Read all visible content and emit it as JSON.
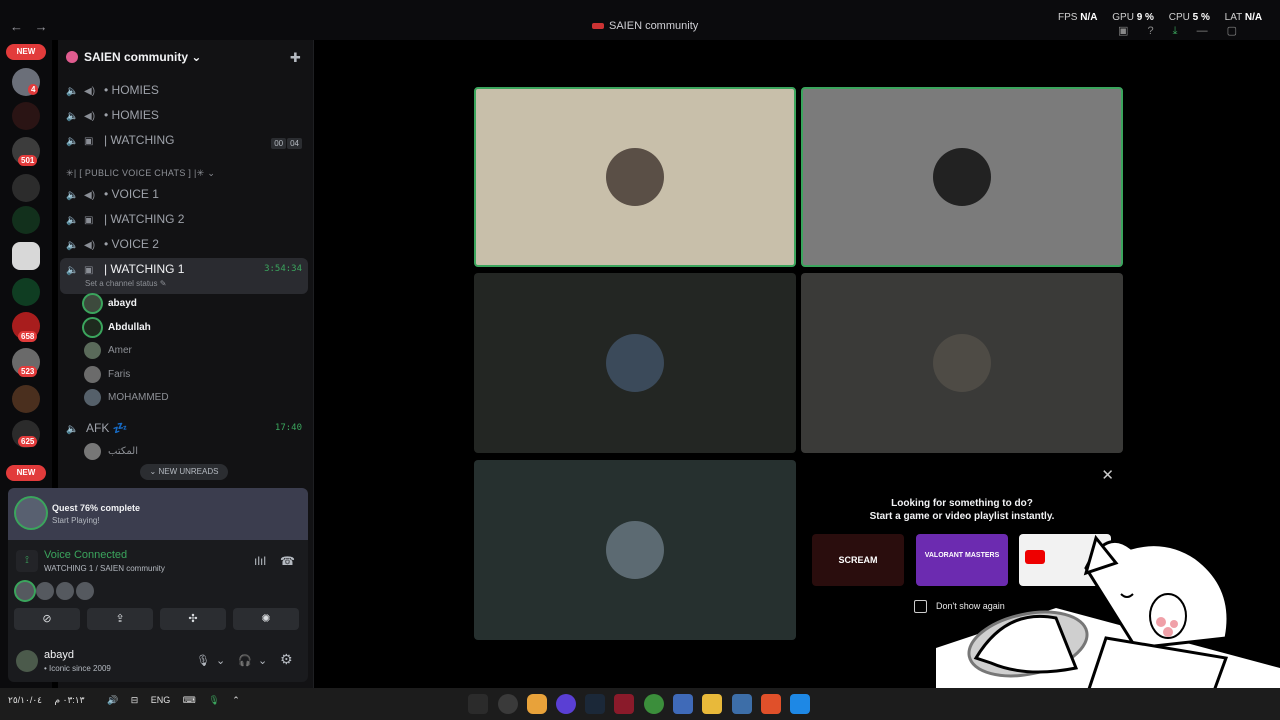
{
  "window": {
    "title": "SAIEN community",
    "back_icon": "←",
    "forward_icon": "→"
  },
  "stats": {
    "fps_label": "FPS",
    "fps_value": "N/A",
    "gpu_label": "GPU",
    "gpu_value": "9 %",
    "cpu_label": "CPU",
    "cpu_value": "5 %",
    "lat_label": "LAT",
    "lat_value": "N/A"
  },
  "server_rail": {
    "new_top": "NEW",
    "new_bottom": "NEW",
    "badges": [
      "4",
      "501",
      "658",
      "523",
      "625"
    ]
  },
  "sidebar": {
    "server_name": "SAIEN community",
    "chevron": "⌄",
    "invite_icon": "✚",
    "channels_top": [
      {
        "name": "• HOMIES"
      },
      {
        "name": "• HOMIES"
      },
      {
        "name": "| WATCHING",
        "counter_a": "00",
        "counter_b": "04"
      }
    ],
    "category": "✳| [ PUBLIC VOICE CHATS ] |✳ ⌄",
    "channels": [
      {
        "name": "• VOICE 1"
      },
      {
        "name": "| WATCHING 2"
      },
      {
        "name": "• VOICE 2"
      }
    ],
    "active_channel": {
      "name": "| WATCHING 1",
      "timer": "3:54:34",
      "status": "Set a channel status ✎"
    },
    "members": [
      "abayd",
      "Abdullah",
      "Amer",
      "Faris",
      "MOHAMMED"
    ],
    "afk": {
      "name": "AFK 💤",
      "timer": "17:40"
    },
    "afk_member": "المكتب",
    "new_unreads": "⌄ NEW UNREADS"
  },
  "quest": {
    "title": "Quest 76% complete",
    "subtitle": "Start Playing!"
  },
  "voice": {
    "status": "Voice Connected",
    "location": "WATCHING 1 / SAIEN community",
    "signal_icon": "⟟",
    "soundboard_icon": "ılıl",
    "disconnect_icon": "☎",
    "actions": [
      "⊘",
      "⇪",
      "✣",
      "✺"
    ]
  },
  "user": {
    "name": "abayd",
    "status": "• Iconic since 2009",
    "mic_icon": "🎙",
    "headphones_icon": "🎧",
    "settings_icon": "⚙",
    "dropdown_icon": "⌄"
  },
  "activity": {
    "close_icon": "✕",
    "line1": "Looking for something to do?",
    "line2": "Start a game or video playlist instantly.",
    "cards": [
      "SCREAM",
      "VALORANT MASTERS",
      ""
    ],
    "dont_show": "Don't show again"
  },
  "taskbar": {
    "lang": "ENG",
    "clock": "٠٣:١٣ م",
    "date": "٢٥/١٠/٠٤"
  },
  "colors": {
    "accent_green": "#3ba55d",
    "badge_red": "#e23b3b",
    "sidebar_bg": "#121214",
    "tile_1": "#c8bfaa",
    "tile_2": "#7b7b7b",
    "tile_3": "#232623",
    "tile_4": "#3a3a38",
    "tile_5": "#26302f"
  }
}
